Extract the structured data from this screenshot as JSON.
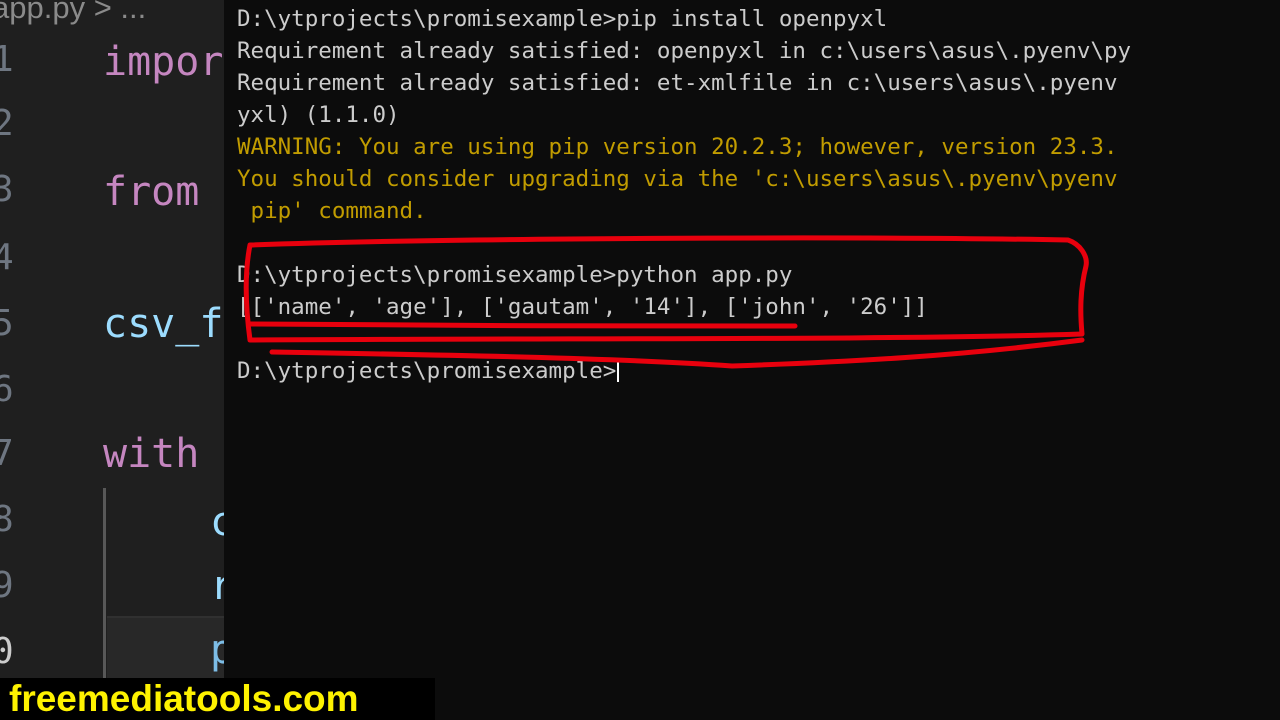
{
  "editor": {
    "breadcrumb": "app.py > ...",
    "line_numbers": [
      "1",
      "2",
      "3",
      "4",
      "5",
      "6",
      "7",
      "8",
      "9",
      "0"
    ],
    "code_lines": [
      {
        "text": "impor",
        "style": "control-keyword"
      },
      {
        "text": "from",
        "style": "control-keyword"
      },
      {
        "text": "csv_f",
        "style": "variable"
      },
      {
        "text": "with",
        "style": "control-keyword"
      },
      {
        "text": "c",
        "style": "variable"
      },
      {
        "text": "r",
        "style": "variable"
      },
      {
        "text": "p",
        "style": "function"
      }
    ]
  },
  "terminal": {
    "lines": [
      {
        "text": "D:\\ytprojects\\promisexample>pip install openpyxl",
        "type": "normal"
      },
      {
        "text": "Requirement already satisfied: openpyxl in c:\\users\\asus\\.pyenv\\py",
        "type": "normal"
      },
      {
        "text": "Requirement already satisfied: et-xmlfile in c:\\users\\asus\\.pyenv",
        "type": "normal"
      },
      {
        "text": "yxl) (1.1.0)",
        "type": "normal"
      },
      {
        "text": "WARNING: You are using pip version 20.2.3; however, version 23.3.",
        "type": "warning"
      },
      {
        "text": "You should consider upgrading via the 'c:\\users\\asus\\.pyenv\\pyenv",
        "type": "warning"
      },
      {
        "text": " pip' command.",
        "type": "warning"
      },
      {
        "text": "",
        "type": "normal"
      },
      {
        "text": "D:\\ytprojects\\promisexample>python app.py",
        "type": "normal"
      },
      {
        "text": "[['name', 'age'], ['gautam', '14'], ['john', '26']]",
        "type": "normal"
      },
      {
        "text": "",
        "type": "normal"
      },
      {
        "text": "D:\\ytprojects\\promisexample>",
        "type": "prompt"
      }
    ]
  },
  "watermark": {
    "text": "freemediatools.com"
  },
  "colors": {
    "terminal_background": "#0c0c0c",
    "terminal_text": "#cccccc",
    "warning_text": "#c19c00",
    "annotation_red": "#e8000d",
    "watermark_text": "#fef200",
    "watermark_background": "#000000"
  }
}
